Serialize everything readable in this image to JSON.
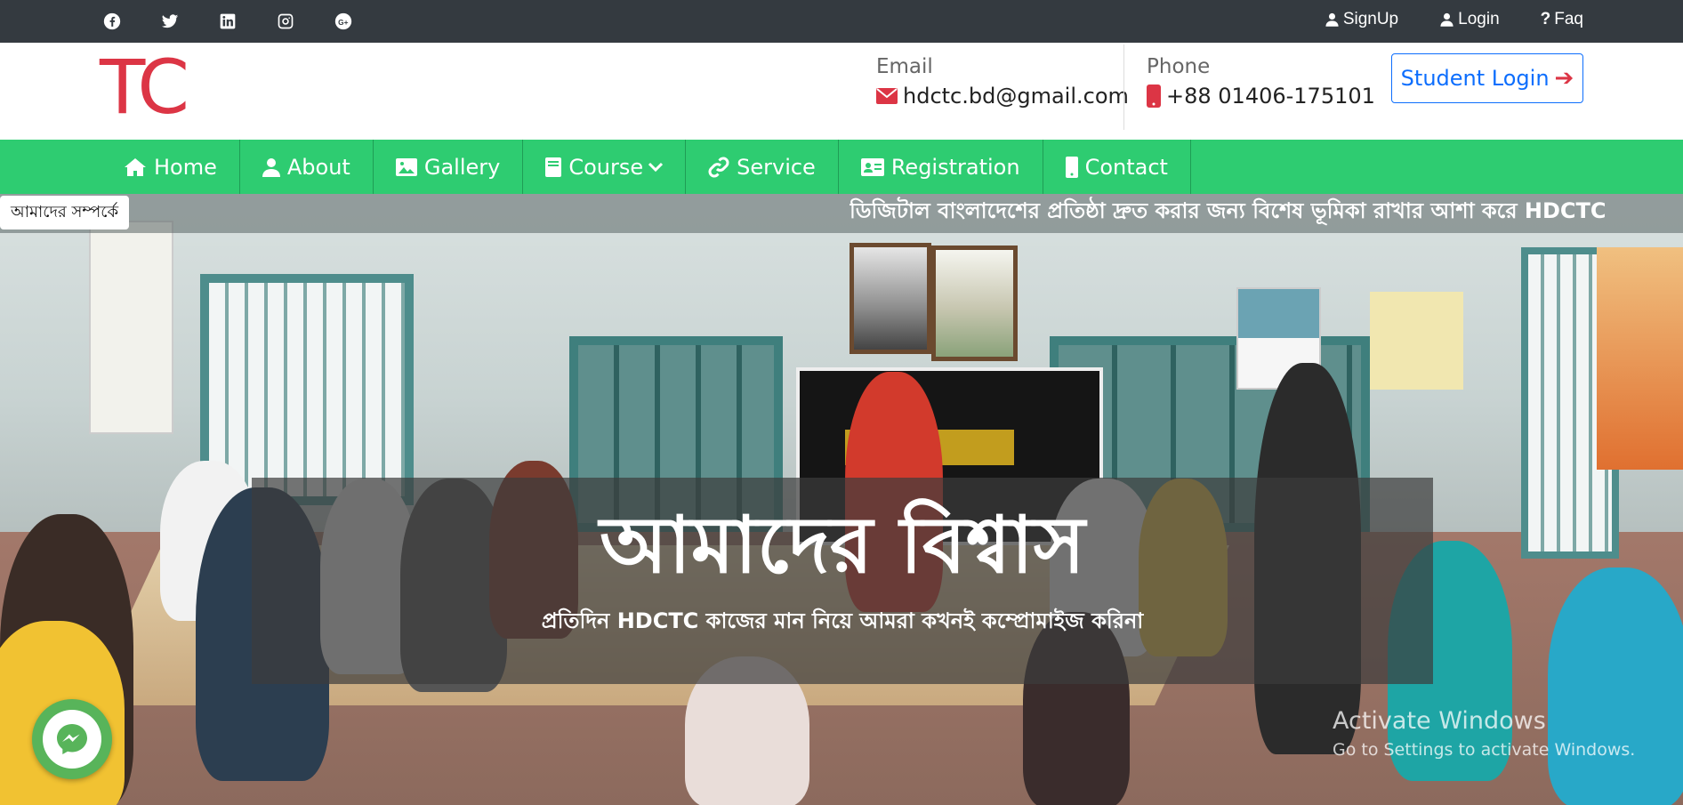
{
  "topbar": {
    "social_icons": [
      "facebook-icon",
      "twitter-icon",
      "linkedin-icon",
      "instagram-icon",
      "google-plus-icon"
    ],
    "links": {
      "signup": "SignUp",
      "login": "Login",
      "faq": "Faq"
    }
  },
  "header": {
    "logo_text": "TC",
    "email_label": "Email",
    "email_value": "hdctc.bd@gmail.com",
    "phone_label": "Phone",
    "phone_value": "+88 01406-175101",
    "student_login": "Student Login"
  },
  "nav": {
    "items": [
      {
        "label": "Home",
        "icon": "home-icon"
      },
      {
        "label": "About",
        "icon": "user-icon"
      },
      {
        "label": "Gallery",
        "icon": "image-icon"
      },
      {
        "label": "Course",
        "icon": "book-icon"
      },
      {
        "label": "Service",
        "icon": "link-icon"
      },
      {
        "label": "Registration",
        "icon": "id-card-icon"
      },
      {
        "label": "Contact",
        "icon": "mobile-icon"
      }
    ]
  },
  "marquee": {
    "tag": "আমাদের সম্পর্কে",
    "text": "ডিজিটাল বাংলাদেশের প্রতিষ্ঠা দ্রুত করার জন্য বিশেষ ভূমিকা রাখার আশা করে HDCTC"
  },
  "hero": {
    "title": "আমাদের বিশ্বাস",
    "subtitle": "প্রতিদিন HDCTC কাজের মান নিয়ে আমরা কখনই কম্প্রোমাইজ করিনা"
  },
  "watermark": {
    "line1": "Activate Windows",
    "line2": "Go to Settings to activate Windows."
  },
  "colors": {
    "topbar": "#343a40",
    "nav": "#2ecc71",
    "accent_red": "#dc3545",
    "accent_blue": "#0d6efd"
  }
}
